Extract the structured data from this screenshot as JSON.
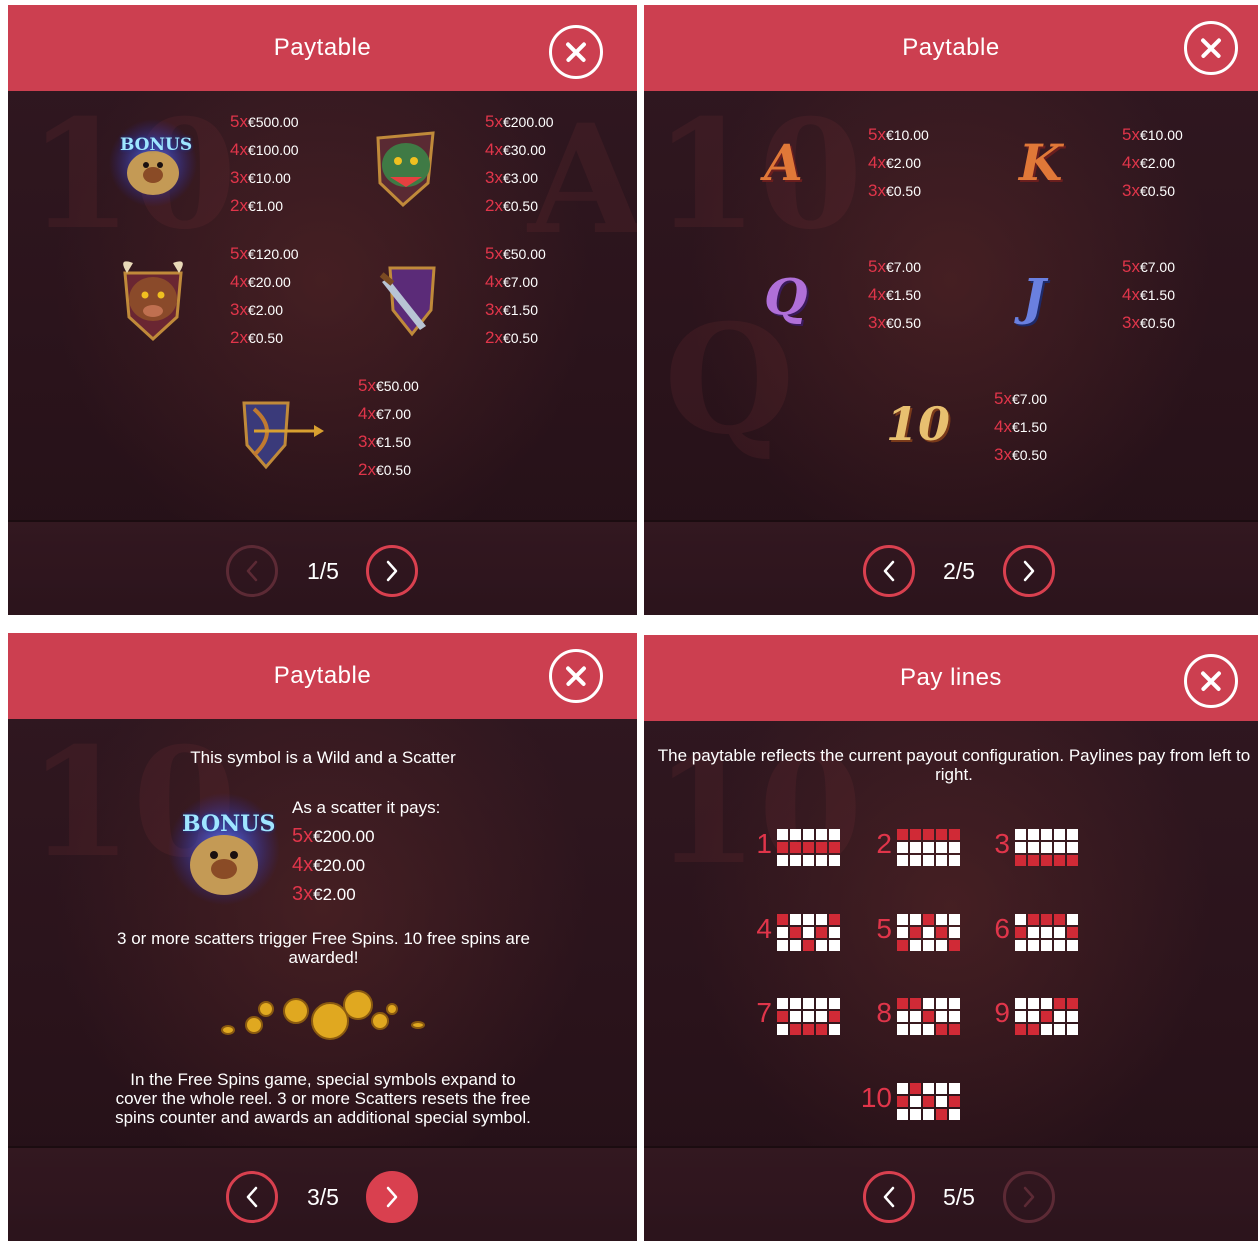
{
  "panels": [
    {
      "title": "Paytable",
      "page": "1/5",
      "symbols": [
        {
          "name": "bonus",
          "label": "BONUS",
          "pays": [
            [
              "5x",
              "€500.00"
            ],
            [
              "4x",
              "€100.00"
            ],
            [
              "3x",
              "€10.00"
            ],
            [
              "2x",
              "€1.00"
            ]
          ]
        },
        {
          "name": "dragon",
          "pays": [
            [
              "5x",
              "€200.00"
            ],
            [
              "4x",
              "€30.00"
            ],
            [
              "3x",
              "€3.00"
            ],
            [
              "2x",
              "€0.50"
            ]
          ]
        },
        {
          "name": "bull",
          "pays": [
            [
              "5x",
              "€120.00"
            ],
            [
              "4x",
              "€20.00"
            ],
            [
              "3x",
              "€2.00"
            ],
            [
              "2x",
              "€0.50"
            ]
          ]
        },
        {
          "name": "sword",
          "pays": [
            [
              "5x",
              "€50.00"
            ],
            [
              "4x",
              "€7.00"
            ],
            [
              "3x",
              "€1.50"
            ],
            [
              "2x",
              "€0.50"
            ]
          ]
        },
        {
          "name": "bow",
          "pays": [
            [
              "5x",
              "€50.00"
            ],
            [
              "4x",
              "€7.00"
            ],
            [
              "3x",
              "€1.50"
            ],
            [
              "2x",
              "€0.50"
            ]
          ]
        }
      ]
    },
    {
      "title": "Paytable",
      "page": "2/5",
      "symbols": [
        {
          "glyph": "A",
          "pays": [
            [
              "5x",
              "€10.00"
            ],
            [
              "4x",
              "€2.00"
            ],
            [
              "3x",
              "€0.50"
            ]
          ]
        },
        {
          "glyph": "K",
          "pays": [
            [
              "5x",
              "€10.00"
            ],
            [
              "4x",
              "€2.00"
            ],
            [
              "3x",
              "€0.50"
            ]
          ]
        },
        {
          "glyph": "Q",
          "pays": [
            [
              "5x",
              "€7.00"
            ],
            [
              "4x",
              "€1.50"
            ],
            [
              "3x",
              "€0.50"
            ]
          ]
        },
        {
          "glyph": "J",
          "pays": [
            [
              "5x",
              "€7.00"
            ],
            [
              "4x",
              "€1.50"
            ],
            [
              "3x",
              "€0.50"
            ]
          ]
        },
        {
          "glyph": "10",
          "pays": [
            [
              "5x",
              "€7.00"
            ],
            [
              "4x",
              "€1.50"
            ],
            [
              "3x",
              "€0.50"
            ]
          ]
        }
      ]
    },
    {
      "title": "Paytable",
      "page": "3/5",
      "wild_text": "This symbol is a Wild and a Scatter",
      "scatter_title": "As a scatter it pays:",
      "bonus_label": "BONUS",
      "scatter_pays": [
        [
          "5x",
          "€200.00"
        ],
        [
          "4x",
          "€20.00"
        ],
        [
          "3x",
          "€2.00"
        ]
      ],
      "free_spins_text": "3 or more scatters trigger Free Spins. 10 free spins are awarded!",
      "free_spins_game_text": "In the Free Spins game, special symbols expand to cover the whole reel. 3 or more Scatters resets the free spins counter and awards an additional special symbol."
    },
    {
      "title": "Pay lines",
      "page": "5/5",
      "intro": "The paytable reflects the current payout configuration. Paylines pay from left to right.",
      "lines": [
        {
          "label": "1",
          "pattern": [
            [
              0,
              0,
              0,
              0,
              0
            ],
            [
              1,
              1,
              1,
              1,
              1
            ],
            [
              0,
              0,
              0,
              0,
              0
            ]
          ]
        },
        {
          "label": "2",
          "pattern": [
            [
              1,
              1,
              1,
              1,
              1
            ],
            [
              0,
              0,
              0,
              0,
              0
            ],
            [
              0,
              0,
              0,
              0,
              0
            ]
          ]
        },
        {
          "label": "3",
          "pattern": [
            [
              0,
              0,
              0,
              0,
              0
            ],
            [
              0,
              0,
              0,
              0,
              0
            ],
            [
              1,
              1,
              1,
              1,
              1
            ]
          ]
        },
        {
          "label": "4",
          "pattern": [
            [
              1,
              0,
              0,
              0,
              1
            ],
            [
              0,
              1,
              0,
              1,
              0
            ],
            [
              0,
              0,
              1,
              0,
              0
            ]
          ]
        },
        {
          "label": "5",
          "pattern": [
            [
              0,
              0,
              1,
              0,
              0
            ],
            [
              0,
              1,
              0,
              1,
              0
            ],
            [
              1,
              0,
              0,
              0,
              1
            ]
          ]
        },
        {
          "label": "6",
          "pattern": [
            [
              0,
              1,
              1,
              1,
              0
            ],
            [
              1,
              0,
              0,
              0,
              1
            ],
            [
              0,
              0,
              0,
              0,
              0
            ]
          ]
        },
        {
          "label": "7",
          "pattern": [
            [
              0,
              0,
              0,
              0,
              0
            ],
            [
              1,
              0,
              0,
              0,
              1
            ],
            [
              0,
              1,
              1,
              1,
              0
            ]
          ]
        },
        {
          "label": "8",
          "pattern": [
            [
              1,
              1,
              0,
              0,
              0
            ],
            [
              0,
              0,
              1,
              0,
              0
            ],
            [
              0,
              0,
              0,
              1,
              1
            ]
          ]
        },
        {
          "label": "9",
          "pattern": [
            [
              0,
              0,
              0,
              1,
              1
            ],
            [
              0,
              0,
              1,
              0,
              0
            ],
            [
              1,
              1,
              0,
              0,
              0
            ]
          ]
        },
        {
          "label": "10",
          "pattern": [
            [
              0,
              1,
              0,
              0,
              0
            ],
            [
              1,
              0,
              1,
              0,
              1
            ],
            [
              0,
              0,
              0,
              1,
              0
            ]
          ]
        }
      ]
    }
  ],
  "colors": {
    "header": "#cc3f50",
    "accent": "#e0354a",
    "background": "#2a141c",
    "payline_on": "#d02a36"
  },
  "icons": {
    "close": "close-icon",
    "prev": "chevron-left-icon",
    "next": "chevron-right-icon"
  }
}
